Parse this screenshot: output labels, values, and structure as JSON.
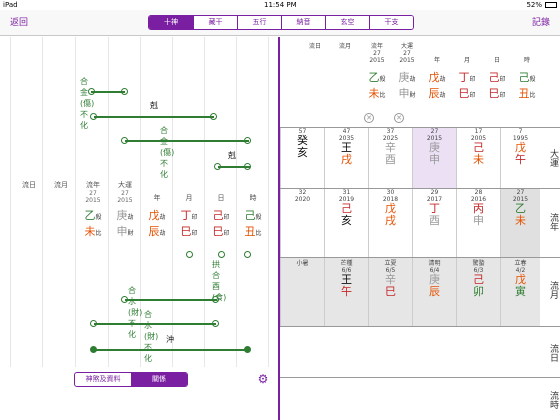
{
  "status": {
    "left": "iPad",
    "time": "11:54 PM",
    "battery": "52%"
  },
  "nav": {
    "back": "返回",
    "record": "記錄",
    "tabs": [
      "十神",
      "藏干",
      "五行",
      "納音",
      "玄空",
      "干支"
    ]
  },
  "left": {
    "headers": [
      {
        "t": "流日",
        "s": ""
      },
      {
        "t": "流月",
        "s": ""
      },
      {
        "t": "流年",
        "s": "27\n2015"
      },
      {
        "t": "大運",
        "s": "27\n2015"
      },
      {
        "t": "年",
        "s": ""
      },
      {
        "t": "月",
        "s": ""
      },
      {
        "t": "日",
        "s": ""
      },
      {
        "t": "時",
        "s": ""
      }
    ],
    "pillars": [
      {
        "stem": "乙",
        "stemTag": "殺",
        "branch": "未",
        "branchTag": "比",
        "hidden": "印\n殺"
      },
      {
        "stem": "庚",
        "stemTag": "劫",
        "branch": "申",
        "branchTag": "財",
        "hidden": "傷\n劫"
      },
      {
        "stem": "戊",
        "stemTag": "劫",
        "branch": "辰",
        "branchTag": "劫",
        "hidden": "殺\n才"
      },
      {
        "stem": "丁",
        "stemTag": "印",
        "branch": "巳",
        "branchTag": "印",
        "hidden": "劫\n傷"
      },
      {
        "stem": "己",
        "stemTag": "印",
        "branch": "巳",
        "branchTag": "印",
        "hidden": "劫\n傷"
      },
      {
        "stem": "己",
        "stemTag": "殺",
        "branch": "丑",
        "branchTag": "比",
        "hidden": "傷\n才"
      }
    ],
    "relations": [
      {
        "label": "合金(傷)不化",
        "color": "#2e7d32"
      },
      {
        "label": "剋",
        "color": "#111"
      },
      {
        "label": "合金(傷)不化",
        "color": "#2e7d32"
      },
      {
        "label": "剋",
        "color": "#111"
      },
      {
        "label": "拱合酉(食)",
        "color": "#2e7d32"
      },
      {
        "label": "合水(財)不化",
        "color": "#2e7d32"
      },
      {
        "label": "合水(財)不化",
        "color": "#2e7d32"
      },
      {
        "label": "沖",
        "color": "#111"
      }
    ],
    "bottomTabs": [
      "神煞及資料",
      "關係"
    ]
  },
  "right": {
    "topHeaders": [
      "流日",
      "流月",
      "流年\n27\n2015",
      "大運\n27\n2015",
      "年",
      "月",
      "日",
      "時"
    ],
    "topPillars": [
      {
        "stem": "乙",
        "tag": "殺",
        "branch": "未",
        "btag": "比"
      },
      {
        "stem": "庚",
        "tag": "劫",
        "branch": "申",
        "btag": "財"
      },
      {
        "stem": "戊",
        "tag": "劫",
        "branch": "辰",
        "btag": "劫"
      },
      {
        "stem": "丁",
        "tag": "印",
        "branch": "巳",
        "btag": "印"
      },
      {
        "stem": "己",
        "tag": "印",
        "branch": "巳",
        "btag": "印"
      },
      {
        "stem": "己",
        "tag": "殺",
        "branch": "丑",
        "btag": "比"
      }
    ],
    "dayun": [
      {
        "age": "57",
        "year": "",
        "s": "癸",
        "b": "亥"
      },
      {
        "age": "47",
        "year": "2035",
        "s": "王",
        "b": "戌"
      },
      {
        "age": "37",
        "year": "2025",
        "s": "辛",
        "b": "酉"
      },
      {
        "age": "27",
        "year": "2015",
        "s": "庚",
        "b": "申"
      },
      {
        "age": "17",
        "year": "2005",
        "s": "己",
        "b": "未"
      },
      {
        "age": "7",
        "year": "1995",
        "s": "戊",
        "b": "午"
      }
    ],
    "liunian": [
      {
        "age": "32",
        "year": "2020",
        "s": "",
        "b": ""
      },
      {
        "age": "31",
        "year": "2019",
        "s": "己",
        "b": "亥"
      },
      {
        "age": "30",
        "year": "2018",
        "s": "戊",
        "b": "戌"
      },
      {
        "age": "29",
        "year": "2017",
        "s": "丁",
        "b": "酉"
      },
      {
        "age": "28",
        "year": "2016",
        "s": "丙",
        "b": "申"
      },
      {
        "age": "27",
        "year": "2015",
        "s": "乙",
        "b": "未"
      }
    ],
    "liuyue": [
      {
        "term": "小暑",
        "date": "",
        "s": "",
        "b": ""
      },
      {
        "term": "芒種",
        "date": "6/6",
        "s": "王",
        "b": "午"
      },
      {
        "term": "立夏",
        "date": "6/5",
        "s": "辛",
        "b": "巳"
      },
      {
        "term": "清明",
        "date": "6/4",
        "s": "庚",
        "b": "辰"
      },
      {
        "term": "驚蟄",
        "date": "6/3",
        "s": "己",
        "b": "卯"
      },
      {
        "term": "立春",
        "date": "4/2",
        "s": "戊",
        "b": "寅"
      }
    ],
    "sideLabels": [
      "大運",
      "流年",
      "流月",
      "流日",
      "流時"
    ]
  }
}
